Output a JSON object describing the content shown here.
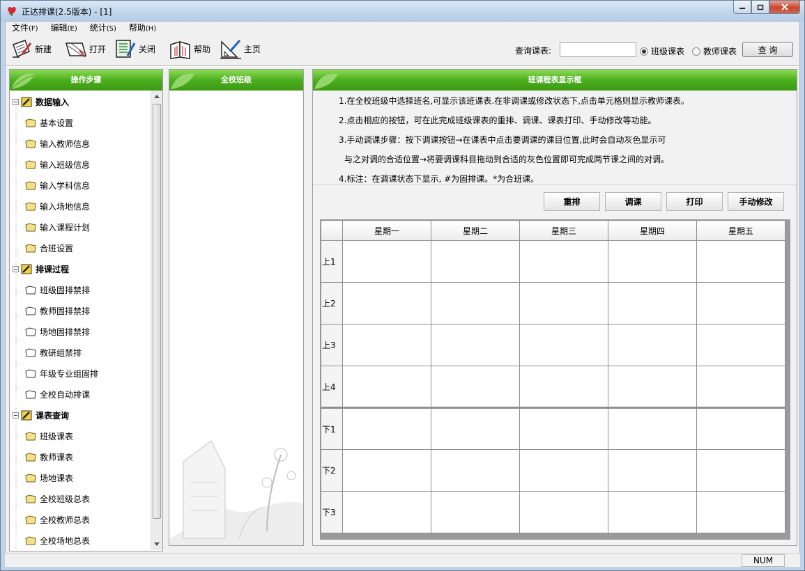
{
  "window": {
    "title": "正达排课(2.5版本)  - [1]"
  },
  "menu": {
    "items": [
      {
        "label": "文件",
        "accel": "(F)"
      },
      {
        "label": "编辑",
        "accel": "(E)"
      },
      {
        "label": "统计",
        "accel": "(S)"
      },
      {
        "label": "帮助",
        "accel": "(H)"
      }
    ]
  },
  "toolbar": {
    "new_label": "新建",
    "open_label": "打开",
    "close_label": "关闭",
    "help_label": "帮助",
    "home_label": "主页"
  },
  "query": {
    "label": "查询课表:",
    "value": "",
    "radio_class": "班级课表",
    "radio_teacher": "教师课表",
    "selected": "班级课表",
    "button": "查 询"
  },
  "left_panel": {
    "header": "操作步骤",
    "groups": [
      {
        "title": "数据输入",
        "items": [
          "基本设置",
          "输入教师信息",
          "输入班级信息",
          "输入学科信息",
          "输入场地信息",
          "输入课程计划",
          "合班设置"
        ]
      },
      {
        "title": "排课过程",
        "items": [
          "班级固排禁排",
          "教师固排禁排",
          "场地固排禁排",
          "教研组禁排",
          "年级专业组固排",
          "全校自动排课"
        ]
      },
      {
        "title": "课表查询",
        "items": [
          "班级课表",
          "教师课表",
          "场地课表",
          "全校班级总表",
          "全校教师总表",
          "全校场地总表"
        ]
      }
    ]
  },
  "middle_panel": {
    "header": "全校班级"
  },
  "right_panel": {
    "header": "班课程表显示框",
    "instructions": [
      "1.在全校班级中选择班名,可显示该班课表.在非调课或修改状态下,点击单元格则显示教师课表。",
      "2.点击相应的按钮，可在此完成班级课表的重排、调课、课表打印、手动修改等功能。",
      "3.手动调课步骤：按下调课按钮→在课表中点击要调课的课目位置,此时会自动灰色显示可",
      "与之对调的合适位置→将要调课科目拖动到合适的灰色位置即可完成两节课之间的对调。",
      "4.标注：在调课状态下显示, #为固排课。*为合班课。"
    ],
    "buttons": {
      "rearrange": "重排",
      "adjust": "调课",
      "print": "打印",
      "manual": "手动修改"
    },
    "timetable": {
      "days": [
        "星期一",
        "星期二",
        "星期三",
        "星期四",
        "星期五"
      ],
      "morning": [
        "上1",
        "上2",
        "上3",
        "上4"
      ],
      "afternoon": [
        "下1",
        "下2",
        "下3"
      ]
    }
  },
  "status": {
    "num": "NUM"
  }
}
